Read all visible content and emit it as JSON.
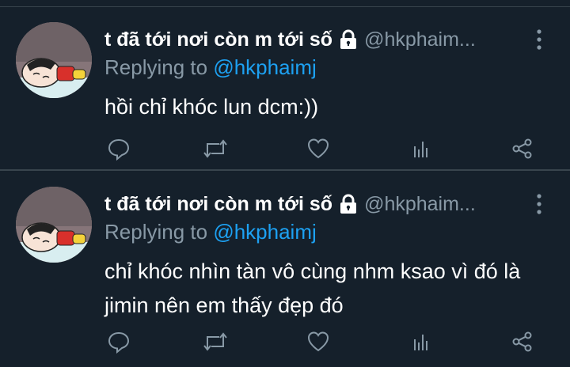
{
  "tweets": [
    {
      "name": "t đã tới nơi còn m tới số",
      "handle": "@hkphaim...",
      "replying_prefix": "Replying to",
      "replying_to": "@hkphaimj",
      "text": "hồi chỉ khóc lun dcm:))"
    },
    {
      "name": "t đã tới nơi còn m tới số",
      "handle": "@hkphaim...",
      "replying_prefix": "Replying to",
      "replying_to": "@hkphaimj",
      "text": "chỉ khóc nhìn tàn vô cùng nhm ksao vì đó là jimin nên em thấy đẹp đó"
    }
  ],
  "icons": {
    "lock": "lock-icon",
    "more": "more-vertical-icon",
    "reply": "reply-icon",
    "retweet": "retweet-icon",
    "like": "heart-icon",
    "stats": "analytics-icon",
    "share": "share-icon"
  },
  "colors": {
    "background": "#15202b",
    "accent": "#1da1f2",
    "secondary_text": "#8899a6",
    "divider": "#38444d"
  }
}
